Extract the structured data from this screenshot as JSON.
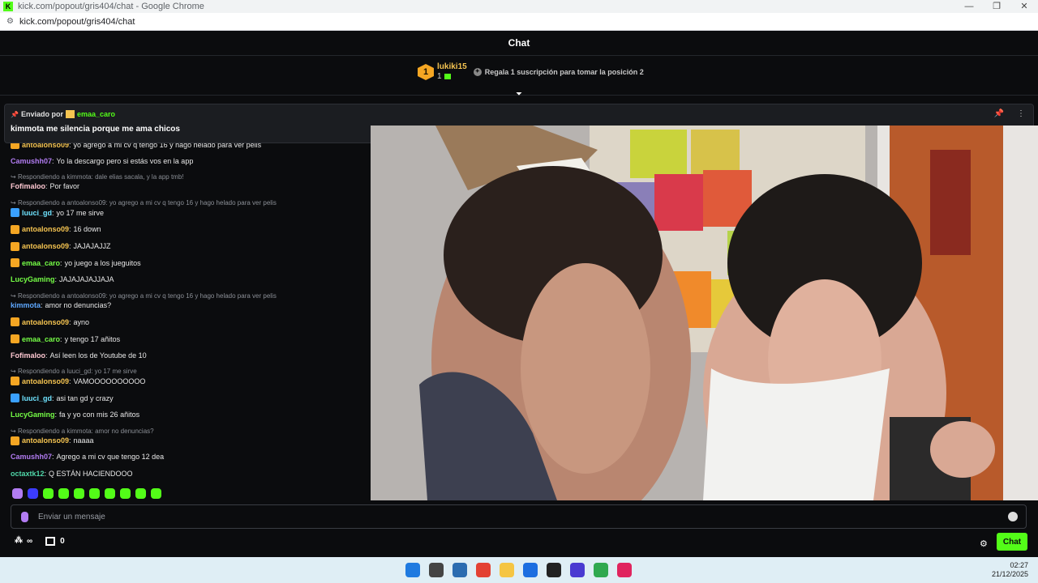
{
  "window": {
    "title": "kick.com/popout/gris404/chat - Google Chrome",
    "url": "kick.com/popout/gris404/chat",
    "controls": [
      "—",
      "❐",
      "✕"
    ]
  },
  "chat": {
    "header": "Chat",
    "leaderboard": {
      "rank": "1",
      "username": "lukiki15",
      "count": "1",
      "gift_text": "Regala 1 suscripción para tomar la posición 2"
    },
    "pinned": {
      "prefix": "Enviado por",
      "user": "emaa_caro",
      "message": "kimmota me silencia porque me ama chicos"
    },
    "messages": [
      {
        "kind": "msg",
        "badge": "crown",
        "user": "antoalonso09",
        "color": "#f5c451",
        "text": "yo agrego a mi cv q tengo 16 y hago helado para ver pelis"
      },
      {
        "kind": "msg",
        "badge": "",
        "user": "Camushh07",
        "color": "#b27cf2",
        "text": "Yo la descargo pero si estás vos en la app"
      },
      {
        "kind": "reply",
        "text": "Respondiendo a kimmota: dale elias sacala, y la app tmb!"
      },
      {
        "kind": "msg",
        "badge": "",
        "user": "Fofimaloo",
        "color": "#ffc8d2",
        "text": "Por favor"
      },
      {
        "kind": "reply",
        "text": "Respondiendo a antoalonso09: yo agrego a mi cv q tengo 16 y hago helado para ver pelis"
      },
      {
        "kind": "msg",
        "badge": "verified",
        "user": "luuci_gd",
        "color": "#6fe4ff",
        "text": "yo 17 me sirve"
      },
      {
        "kind": "msg",
        "badge": "crown",
        "user": "antoalonso09",
        "color": "#f5c451",
        "text": "16 down"
      },
      {
        "kind": "msg",
        "badge": "crown",
        "user": "antoalonso09",
        "color": "#f5c451",
        "text": "JAJAJAJJZ"
      },
      {
        "kind": "msg",
        "badge": "crown",
        "user": "emaa_caro",
        "color": "#75fd46",
        "text": "yo juego a los jueguitos"
      },
      {
        "kind": "msg",
        "badge": "",
        "user": "LucyGaming",
        "color": "#75fd46",
        "text": "JAJAJAJAJJAJA"
      },
      {
        "kind": "reply",
        "text": "Respondiendo a antoalonso09: yo agrego a mi cv q tengo 16 y hago helado para ver pelis"
      },
      {
        "kind": "msg",
        "badge": "",
        "user": "kimmota",
        "color": "#5ea8ff",
        "text": "amor no denuncias?"
      },
      {
        "kind": "msg",
        "badge": "crown",
        "user": "antoalonso09",
        "color": "#f5c451",
        "text": "ayno"
      },
      {
        "kind": "msg",
        "badge": "crown",
        "user": "emaa_caro",
        "color": "#75fd46",
        "text": "y tengo 17 añitos"
      },
      {
        "kind": "msg",
        "badge": "",
        "user": "Fofimaloo",
        "color": "#ffc8d2",
        "text": "Así leen los de Youtube de 10"
      },
      {
        "kind": "reply",
        "text": "Respondiendo a luuci_gd: yo 17 me sirve"
      },
      {
        "kind": "msg",
        "badge": "crown",
        "user": "antoalonso09",
        "color": "#f5c451",
        "text": "VAMOOOOOOOOOO"
      },
      {
        "kind": "msg",
        "badge": "verified",
        "user": "luuci_gd",
        "color": "#6fe4ff",
        "text": "asi tan gd y crazy"
      },
      {
        "kind": "msg",
        "badge": "",
        "user": "LucyGaming",
        "color": "#75fd46",
        "text": "fa y yo con mis 26 añitos"
      },
      {
        "kind": "reply",
        "text": "Respondiendo a kimmota: amor no denuncias?"
      },
      {
        "kind": "msg",
        "badge": "crown",
        "user": "antoalonso09",
        "color": "#f5c451",
        "text": "naaaa"
      },
      {
        "kind": "msg",
        "badge": "",
        "user": "Camushh07",
        "color": "#b27cf2",
        "text": "Agrego a mi cv que tengo 12 dea"
      },
      {
        "kind": "msg",
        "badge": "",
        "user": "octaxtk12",
        "color": "#4fd6a8",
        "text": "Q ESTÁN HACIENDOOO"
      }
    ],
    "input": {
      "placeholder": "Enviar un mensaje"
    },
    "points_label": "∞",
    "store_count": "0",
    "send_label": "Chat"
  },
  "taskbar": {
    "time": "02:27",
    "date": "21/12/2025"
  },
  "colors": {
    "accent": "#53fc18",
    "background": "#0b0c0e"
  }
}
